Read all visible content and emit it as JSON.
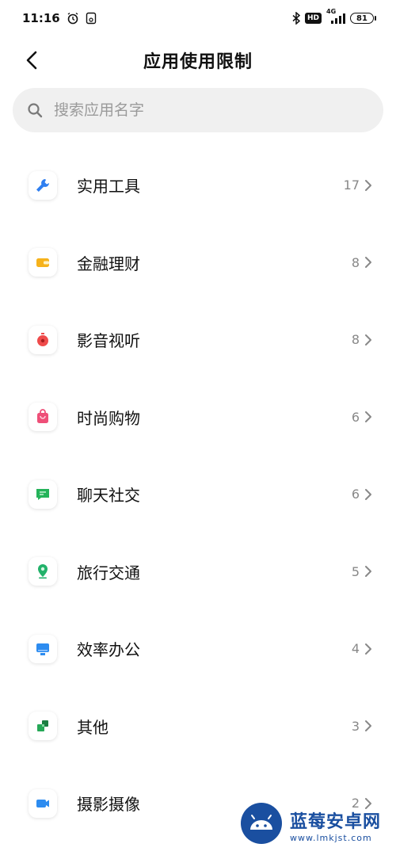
{
  "status_bar": {
    "time": "11:16",
    "hd": "HD",
    "network": "4G",
    "battery": "81"
  },
  "header": {
    "title": "应用使用限制"
  },
  "search": {
    "placeholder": "搜索应用名字"
  },
  "categories": [
    {
      "label": "实用工具",
      "count": "17",
      "icon": "wrench-icon",
      "color": "#2f7ff0"
    },
    {
      "label": "金融理财",
      "count": "8",
      "icon": "wallet-icon",
      "color": "#f6b21b"
    },
    {
      "label": "影音视听",
      "count": "8",
      "icon": "media-icon",
      "color": "#ef4b4b"
    },
    {
      "label": "时尚购物",
      "count": "6",
      "icon": "shopping-bag-icon",
      "color": "#ee4f78"
    },
    {
      "label": "聊天社交",
      "count": "6",
      "icon": "chat-icon",
      "color": "#25b35a"
    },
    {
      "label": "旅行交通",
      "count": "5",
      "icon": "location-pin-icon",
      "color": "#22b26a"
    },
    {
      "label": "效率办公",
      "count": "4",
      "icon": "monitor-icon",
      "color": "#2d8cf0"
    },
    {
      "label": "其他",
      "count": "3",
      "icon": "blocks-icon",
      "color": "#26a857"
    },
    {
      "label": "摄影摄像",
      "count": "2",
      "icon": "camera-icon",
      "color": "#2d8cf0"
    }
  ],
  "watermark": {
    "title": "蓝莓安卓网",
    "url": "www.lmkjst.com"
  }
}
